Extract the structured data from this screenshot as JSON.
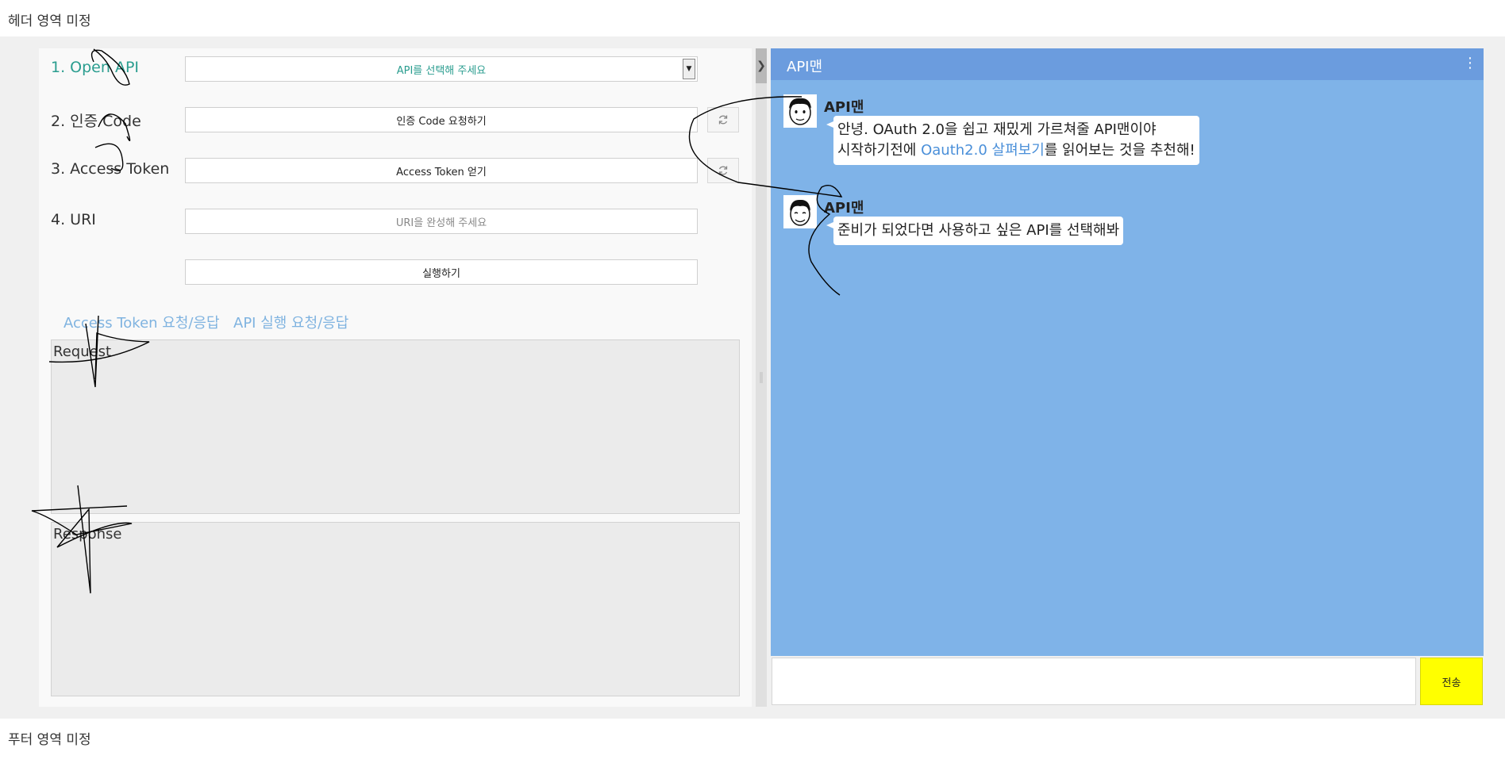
{
  "header": {
    "text": "헤더 영역 미정"
  },
  "footer": {
    "text": "푸터 영역 미정"
  },
  "steps": {
    "open_api": {
      "label": "1. Open API",
      "select_value": "API를 선택해 주세요"
    },
    "auth_code": {
      "label": "2. 인증 Code",
      "button": "인증 Code 요청하기"
    },
    "access_token": {
      "label": "3. Access Token",
      "button": "Access Token 얻기"
    },
    "uri": {
      "label": "4. URI",
      "placeholder": "URI을 완성해 주세요"
    },
    "execute": {
      "button": "실행하기"
    }
  },
  "tabs": [
    "Access Token 요청/응답",
    "API 실행 요청/응답"
  ],
  "request": {
    "label": "Request"
  },
  "response": {
    "label": "Response"
  },
  "chat": {
    "title": "API맨",
    "menu_icon": "⋮",
    "messages": [
      {
        "sender": "API맨",
        "line1": "안녕. OAuth 2.0을 쉽고 재밌게 가르쳐줄 API맨이야",
        "line2_pre": "시작하기전에 ",
        "line2_link": "Oauth2.0 살펴보기",
        "line2_post": "를 읽어보는 것을 추천해!"
      },
      {
        "sender": "API맨",
        "text": "준비가 되었다면 사용하고 싶은 API를 선택해봐"
      }
    ],
    "send_label": "전송"
  },
  "icons": {
    "dropdown": "caret-down-icon",
    "refresh": "refresh-icon",
    "collapse": "chevron-right-icon",
    "avatar": "avatar-face-icon"
  },
  "colors": {
    "active_step": "#2a9d8f",
    "tab_text": "#7fb3e0",
    "chat_bg": "#7fb3e8",
    "chat_header": "#6b9cde",
    "send_button": "#ffff00",
    "link": "#4a8fd9"
  }
}
